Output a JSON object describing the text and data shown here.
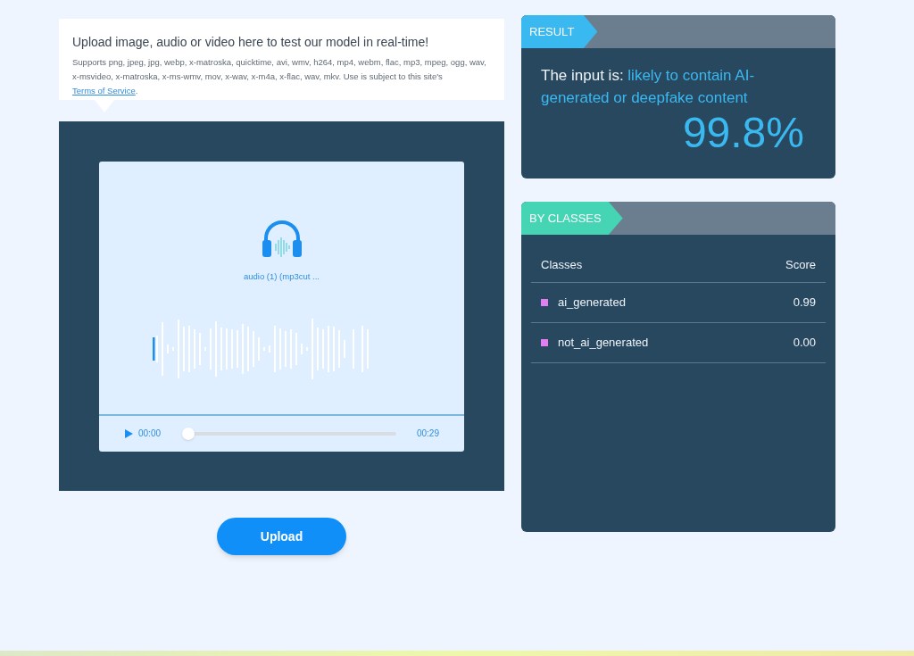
{
  "upload_info": {
    "title": "Upload image, audio or video here to test our model in real-time!",
    "description": "Supports png, jpeg, jpg, webp, x-matroska, quicktime, avi, wmv, h264, mp4, webm, flac, mp3, mpeg, ogg, wav, x-msvideo, x-matroska, x-ms-wmv, mov, x-wav, x-m4a, x-flac, wav, mkv. Use is subject to this site's",
    "link": "Terms of Service",
    "after_link": "."
  },
  "media": {
    "file_name": "audio (1) (mp3cut ...",
    "player": {
      "current_time": "00:00",
      "duration": "00:29",
      "level": 0
    }
  },
  "upload_button": "Upload",
  "result": {
    "tab": "RESULT",
    "prefix": "The input is:",
    "verdict": "likely to contain AI-generated or deepfake content",
    "score": "99.8%"
  },
  "by_classes": {
    "tab": "BY CLASSES",
    "columns": [
      "Classes",
      "Score"
    ],
    "rows": [
      {
        "label": "ai_generated",
        "score": "0.99",
        "color": "#e07ff0"
      },
      {
        "label": "not_ai_generated",
        "score": "0.00",
        "color": "#e07ff0"
      }
    ]
  }
}
